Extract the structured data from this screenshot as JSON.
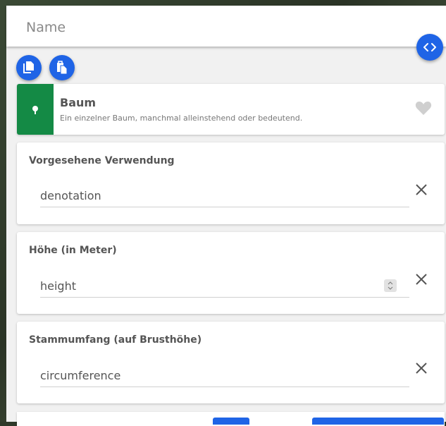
{
  "name_field": {
    "placeholder": "Name"
  },
  "toolbar": {
    "code_toggle_icon": "code-brackets-icon",
    "copy_icon": "copy-icon",
    "paste_icon": "paste-icon"
  },
  "preset": {
    "title": "Baum",
    "description": "Ein einzelner Baum, manchmal alleinstehend oder bedeutend.",
    "icon": "tree-icon",
    "color": "#148a45"
  },
  "fields": [
    {
      "label": "Vorgesehene Verwendung",
      "placeholder": "denotation",
      "type": "text"
    },
    {
      "label": "Höhe (in Meter)",
      "placeholder": "height",
      "type": "number"
    },
    {
      "label": "Stammumfang (auf Brusthöhe)",
      "placeholder": "circumference",
      "type": "text"
    }
  ],
  "colors": {
    "accent": "#1f64e6",
    "preset": "#148a45"
  }
}
